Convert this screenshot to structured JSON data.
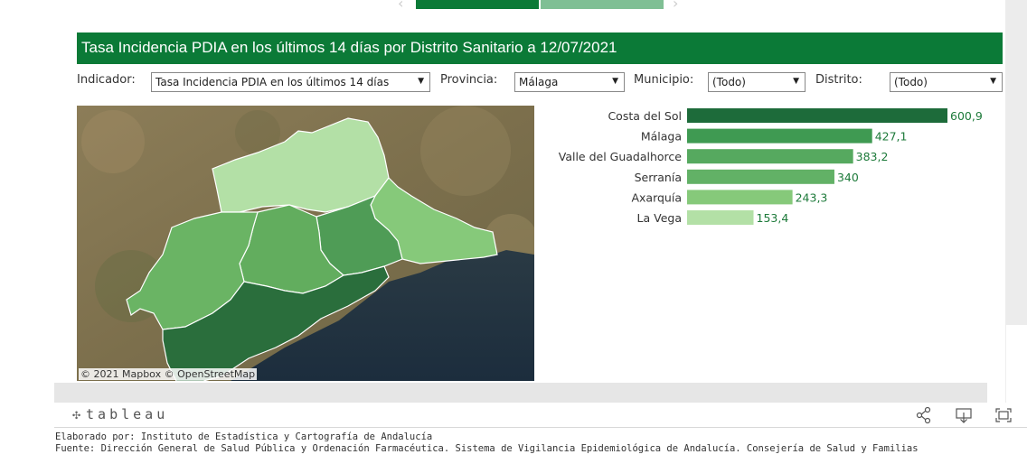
{
  "title": "Tasa Incidencia PDIA en los últimos 14 días por Distrito Sanitario a 12/07/2021",
  "filters": {
    "indicador": {
      "label": "Indicador:",
      "value": "Tasa Incidencia PDIA en los últimos 14 días"
    },
    "provincia": {
      "label": "Provincia:",
      "value": "Málaga"
    },
    "municipio": {
      "label": "Municipio:",
      "value": "(Todo)"
    },
    "distrito": {
      "label": "Distrito:",
      "value": "(Todo)"
    }
  },
  "map": {
    "attribution": "© 2021 Mapbox  © OpenStreetMap"
  },
  "chart_data": {
    "type": "bar",
    "orientation": "horizontal",
    "categories": [
      "Costa del Sol",
      "Málaga",
      "Valle del Guadalhorce",
      "Serranía",
      "Axarquía",
      "La Vega"
    ],
    "values": [
      600.9,
      427.1,
      383.2,
      340,
      243.3,
      153.4
    ],
    "value_labels": [
      "600,9",
      "427,1",
      "383,2",
      "340",
      "243,3",
      "153,4"
    ],
    "colors": [
      "#1d6b3a",
      "#3f9a52",
      "#56a95f",
      "#62b166",
      "#86c97a",
      "#b3e0a6"
    ],
    "label_color": "#1d7a3a",
    "xlim": [
      0,
      600.9
    ],
    "grid": false
  },
  "footer": {
    "brand": "tableau",
    "icons": [
      "share-icon",
      "download-icon",
      "fullscreen-icon"
    ]
  },
  "credits": {
    "line1": "Elaborado por: Instituto de Estadística y Cartografía de Andalucía",
    "line2": "Fuente: Dirección General de Salud Pública y Ordenación Farmacéutica. Sistema de Vigilancia Epidemiológica de Andalucía. Consejería de Salud y Familias"
  },
  "colors": {
    "brand_green": "#0b7a37",
    "tab_light": "#7fbf94"
  }
}
